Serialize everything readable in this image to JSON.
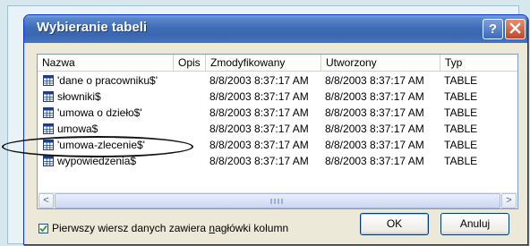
{
  "dialog": {
    "title": "Wybieranie tabeli",
    "help_glyph": "?"
  },
  "columns": [
    "Nazwa",
    "Opis",
    "Zmodyfikowany",
    "Utworzony",
    "Typ"
  ],
  "rows": [
    {
      "name": "'dane o pracowniku$'",
      "modified": "8/8/2003 8:37:17 AM",
      "created": "8/8/2003 8:37:17 AM",
      "type": "TABLE"
    },
    {
      "name": "słowniki$",
      "modified": "8/8/2003 8:37:17 AM",
      "created": "8/8/2003 8:37:17 AM",
      "type": "TABLE"
    },
    {
      "name": "'umowa o dzieło$'",
      "modified": "8/8/2003 8:37:17 AM",
      "created": "8/8/2003 8:37:17 AM",
      "type": "TABLE"
    },
    {
      "name": "umowa$",
      "modified": "8/8/2003 8:37:17 AM",
      "created": "8/8/2003 8:37:17 AM",
      "type": "TABLE"
    },
    {
      "name": "'umowa-zlecenie$'",
      "modified": "8/8/2003 8:37:17 AM",
      "created": "8/8/2003 8:37:17 AM",
      "type": "TABLE"
    },
    {
      "name": "wypowiedzenia$",
      "modified": "8/8/2003 8:37:17 AM",
      "created": "8/8/2003 8:37:17 AM",
      "type": "TABLE"
    }
  ],
  "checkbox": {
    "checked": true,
    "label_before": "Pierwszy wiersz danych zawiera ",
    "label_underlined": "n",
    "label_after": "agłówki kolumn"
  },
  "buttons": {
    "ok": "OK",
    "cancel": "Anuluj"
  },
  "scroll": {
    "left_glyph": "<",
    "right_glyph": ">"
  },
  "icons": {
    "table": "table-grid-icon",
    "help": "help-icon",
    "close": "close-icon"
  }
}
